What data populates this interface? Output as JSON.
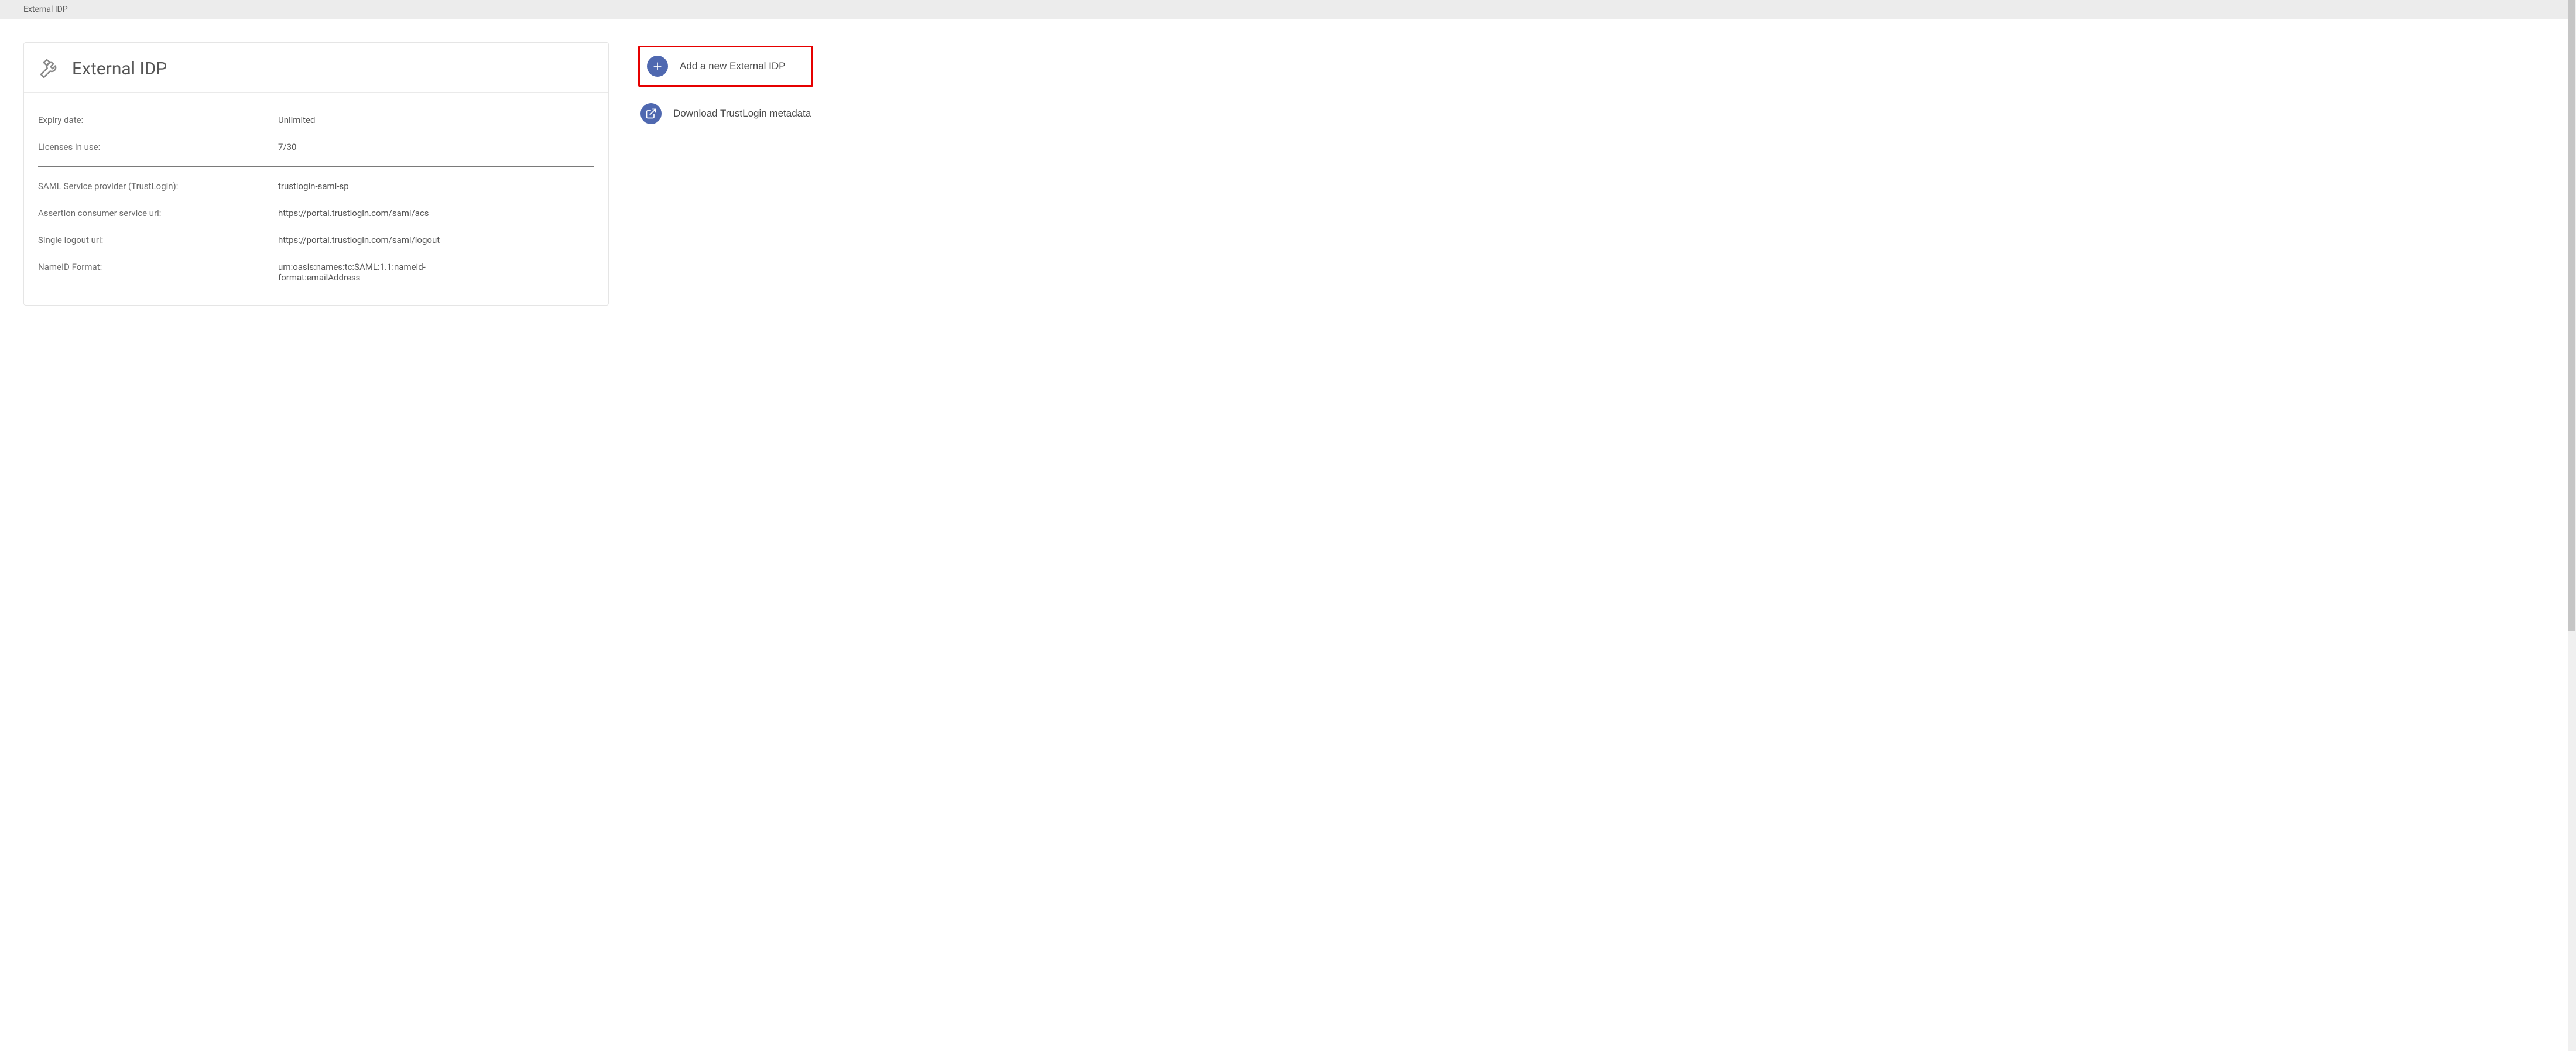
{
  "header": {
    "breadcrumb": "External IDP"
  },
  "panel": {
    "title": "External IDP",
    "rows_top": [
      {
        "label": "Expiry date:",
        "value": "Unlimited"
      },
      {
        "label": "Licenses in use:",
        "value": "7/30"
      }
    ],
    "rows_bottom": [
      {
        "label": "SAML Service provider (TrustLogin):",
        "value": "trustlogin-saml-sp"
      },
      {
        "label": "Assertion consumer service url:",
        "value": "https://portal.trustlogin.com/saml/acs"
      },
      {
        "label": "Single logout url:",
        "value": "https://portal.trustlogin.com/saml/logout"
      },
      {
        "label": "NameID Format:",
        "value": "urn:oasis:names:tc:SAML:1.1:nameid-format:emailAddress"
      }
    ]
  },
  "actions": {
    "add": "Add a new External IDP",
    "download": "Download TrustLogin metadata"
  }
}
